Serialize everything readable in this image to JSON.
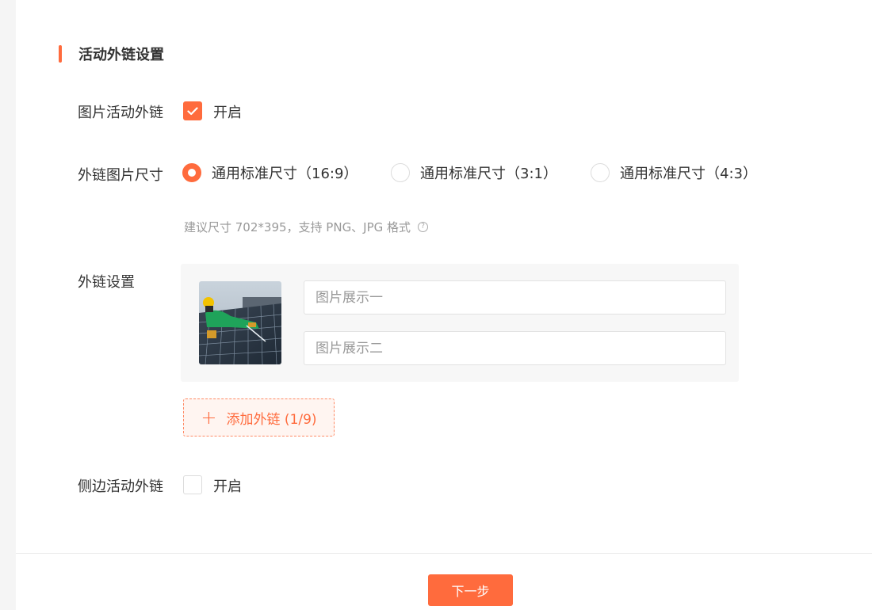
{
  "section": {
    "title": "活动外链设置"
  },
  "image_link": {
    "label": "图片活动外链",
    "checkbox_label": "开启",
    "checked": true
  },
  "link_size": {
    "label": "外链图片尺寸",
    "options": [
      {
        "label": "通用标准尺寸（16:9）",
        "selected": true
      },
      {
        "label": "通用标准尺寸（3:1）",
        "selected": false
      },
      {
        "label": "通用标准尺寸（4:3）",
        "selected": false
      }
    ],
    "hint": "建议尺寸 702*395，支持 PNG、JPG 格式",
    "hint_icon": "question-circle-icon"
  },
  "link_settings": {
    "label": "外链设置",
    "inputs": [
      {
        "placeholder": "图片展示一",
        "value": ""
      },
      {
        "placeholder": "图片展示二",
        "value": ""
      }
    ],
    "add_button_label": "添加外链 (1/9)"
  },
  "side_link": {
    "label": "侧边活动外链",
    "checkbox_label": "开启",
    "checked": false
  },
  "footer": {
    "next_label": "下一步"
  },
  "colors": {
    "accent": "#ff6b3d",
    "text": "#333333",
    "hint": "#999999",
    "panel_bg": "#f7f7f7"
  }
}
